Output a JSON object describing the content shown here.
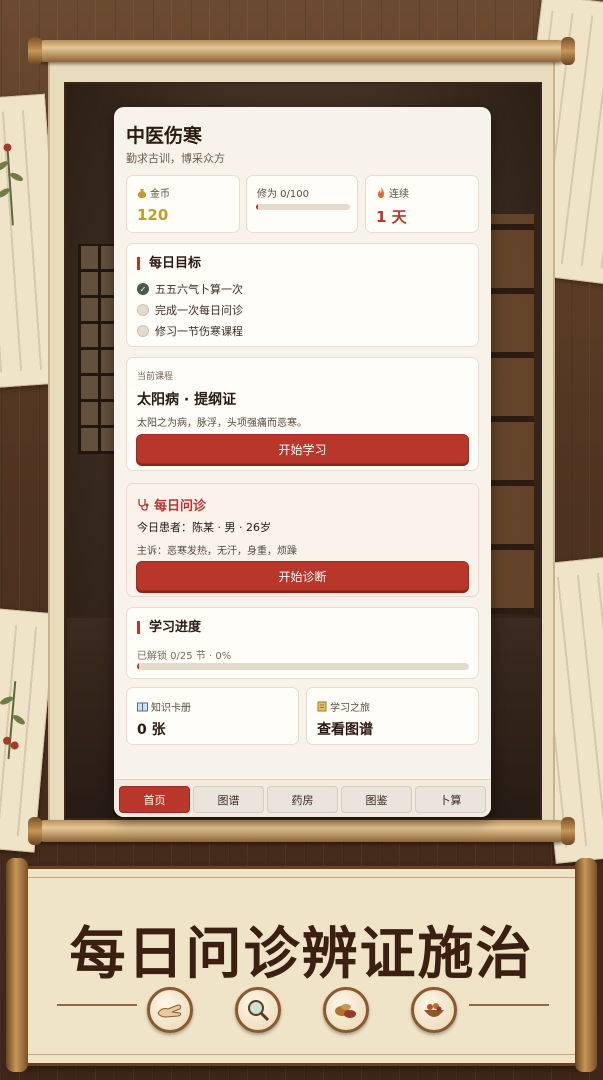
{
  "app": {
    "title": "中医伤寒",
    "subtitle": "勤求古训，博采众方"
  },
  "stats": {
    "coins": {
      "label": "金币",
      "value": "120",
      "icon": "coin-bag-icon"
    },
    "cultivation": {
      "label": "修为 0/100",
      "progress": 0.02
    },
    "streak": {
      "label": "连续",
      "value": "1 天",
      "icon": "flame-icon"
    }
  },
  "daily_goals": {
    "title": "每日目标",
    "tasks": [
      {
        "label": "五五六气卜算一次",
        "done": true
      },
      {
        "label": "完成一次每日问诊",
        "done": false
      },
      {
        "label": "修习一节伤寒课程",
        "done": false
      }
    ]
  },
  "current_course": {
    "label": "当前课程",
    "title": "太阳病 · 提纲证",
    "desc": "太阳之为病，脉浮，头项强痛而恶寒。",
    "button": "开始学习"
  },
  "daily_consult": {
    "title": "每日问诊",
    "icon": "stethoscope-icon",
    "patient": "今日患者：陈某 · 男 · 26岁",
    "complaint": "主诉：恶寒发热，无汗，身重，烦躁",
    "button": "开始诊断"
  },
  "progress": {
    "title": "学习进度",
    "text": "已解锁 0/25 节 · 0%",
    "value": 0.0
  },
  "cards": {
    "knowledge": {
      "label": "知识卡册",
      "value": "0 张",
      "icon": "book-icon"
    },
    "journey": {
      "label": "学习之旅",
      "value": "查看图谱",
      "icon": "scroll-icon"
    }
  },
  "tabs": [
    {
      "label": "首页",
      "active": true
    },
    {
      "label": "图谱",
      "active": false
    },
    {
      "label": "药房",
      "active": false
    },
    {
      "label": "图鉴",
      "active": false
    },
    {
      "label": "卜算",
      "active": false
    }
  ],
  "banner": {
    "text": "每日问诊辨证施治",
    "badges": [
      "pulse-hand-icon",
      "magnifier-herb-icon",
      "herb-pile-icon",
      "herb-bowl-icon"
    ]
  },
  "colors": {
    "accent": "#b9362b",
    "coin": "#c49a2a",
    "panel": "#f8f3ea"
  }
}
